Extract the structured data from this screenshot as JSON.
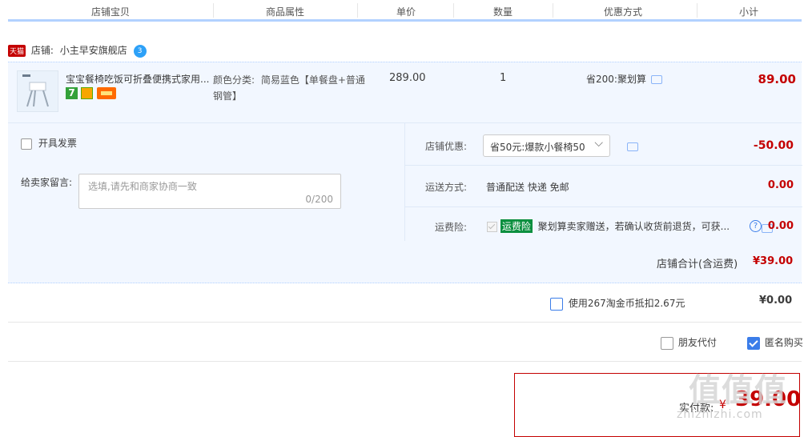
{
  "header": {
    "cols": [
      "店铺宝贝",
      "商品属性",
      "单价",
      "数量",
      "优惠方式",
      "小计"
    ]
  },
  "shop": {
    "tag": "天猫",
    "label": "店铺:",
    "name": "小主早安旗舰店",
    "chat_badge": "3"
  },
  "item": {
    "title": "宝宝餐椅吃饭可折叠便携式家用...",
    "attr_label": "颜色分类:",
    "attr_value": "简易蓝色【单餐盘+普通钢管】",
    "badge_seven": "7",
    "price": "289.00",
    "quantity": "1",
    "discount": "省200:聚划算",
    "subtotal": "89.00"
  },
  "invoice": {
    "label": "开具发票"
  },
  "message": {
    "label": "给卖家留言:",
    "placeholder": "选填,请先和商家协商一致",
    "counter": "0/200"
  },
  "shop_discount": {
    "label": "店铺优惠:",
    "selected": "省50元:爆款小餐椅50",
    "amount": "-50.00"
  },
  "shipping": {
    "label": "运送方式:",
    "value": "普通配送 快递 免邮",
    "amount": "0.00"
  },
  "insurance": {
    "label": "运费险:",
    "tag": "运费险",
    "text": "聚划算卖家赠送，若确认收货前退货，可获...",
    "help": "?",
    "amount": "0.00"
  },
  "shop_total": {
    "label": "店铺合计(含运费)",
    "amount": "¥39.00"
  },
  "coins": {
    "label": "使用267淘金币抵扣2.67元",
    "amount": "¥0.00"
  },
  "options": {
    "friend_pay": "朋友代付",
    "anonymous": "匿名购买"
  },
  "pay": {
    "label": "实付款:",
    "currency": "¥",
    "amount": "39.00"
  },
  "watermark": {
    "main": "值值值",
    "url": "zhizhizhi.com"
  },
  "colors": {
    "accent_red": "#c40000",
    "header_line": "#b2d1ff",
    "panel_bg": "#f2f7ff",
    "checkbox_blue": "#3b7de9"
  }
}
